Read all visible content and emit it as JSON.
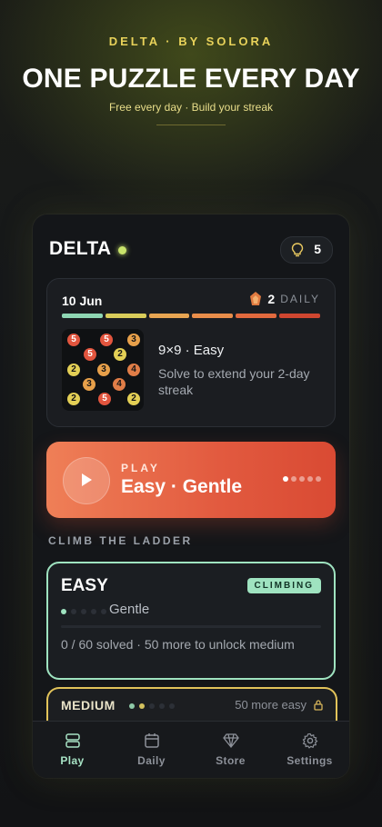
{
  "hero": {
    "brand": "DELTA · BY SOLORA",
    "headline": "ONE PUZZLE EVERY DAY",
    "tagline": "Free every day · Build your streak"
  },
  "app": {
    "logo": "DELTA",
    "hints_icon": "lightbulb-icon",
    "hints_count": "5"
  },
  "daily": {
    "date": "10 Jun",
    "streak_icon": "flame-icon",
    "streak_count": "2",
    "streak_label": "DAILY",
    "puzzle_title": "9×9 · Easy",
    "puzzle_subtitle": "Solve to extend your 2-day streak",
    "board_tiles": [
      "5",
      "5",
      "3",
      "5",
      "2",
      "2",
      "3",
      "4",
      "3",
      "4",
      "2",
      "5",
      "2"
    ]
  },
  "play": {
    "kicker": "PLAY",
    "title": "Easy · Gentle",
    "icon": "play-icon"
  },
  "ladder": {
    "label": "CLIMB THE LADDER",
    "easy": {
      "title": "EASY",
      "badge": "CLIMBING",
      "level": "Gentle",
      "progress_text": "0 / 60 solved · 50 more to unlock medium",
      "solved": 0,
      "total": 60
    },
    "medium": {
      "title": "MEDIUM",
      "lock_text": "50 more easy",
      "lock_icon": "lock-icon"
    }
  },
  "tabs": [
    {
      "label": "Play",
      "icon": "play-stack-icon",
      "active": true
    },
    {
      "label": "Daily",
      "icon": "calendar-icon",
      "active": false
    },
    {
      "label": "Store",
      "icon": "diamond-icon",
      "active": false
    },
    {
      "label": "Settings",
      "icon": "gear-icon",
      "active": false
    }
  ],
  "colors": {
    "accent_green": "#9fe3c0",
    "accent_yellow": "#e8d25a",
    "play_orange": "#e25a3f"
  }
}
